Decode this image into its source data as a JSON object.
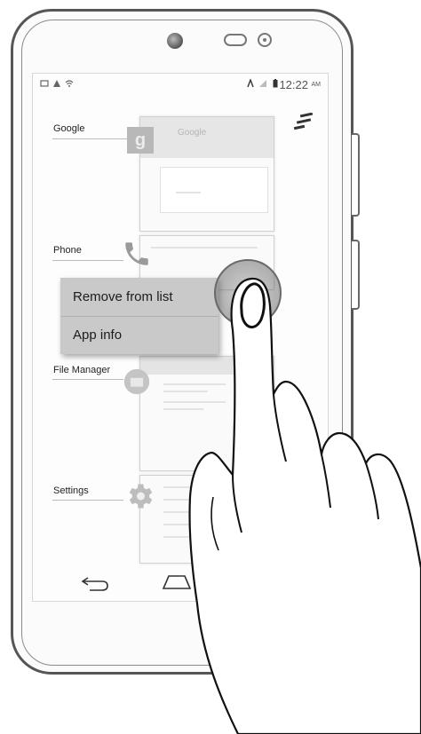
{
  "statusbar": {
    "time": "12:22",
    "ampm": "AM"
  },
  "recents": {
    "apps": [
      {
        "label": "Google",
        "icon": "google-icon",
        "thumb_title": "Google"
      },
      {
        "label": "Phone",
        "icon": "phone-icon"
      },
      {
        "label": "File Manager",
        "icon": "file-manager-icon"
      },
      {
        "label": "Settings",
        "icon": "settings-icon"
      }
    ]
  },
  "context_menu": {
    "remove_label": "Remove from list",
    "info_label": "App info"
  },
  "navbar": {
    "icons": [
      "back-icon",
      "home-icon"
    ]
  },
  "colors": {
    "screen_bg": "#fdfdfd",
    "menu_bg": "#c9c9c9",
    "outline": "#555555"
  }
}
